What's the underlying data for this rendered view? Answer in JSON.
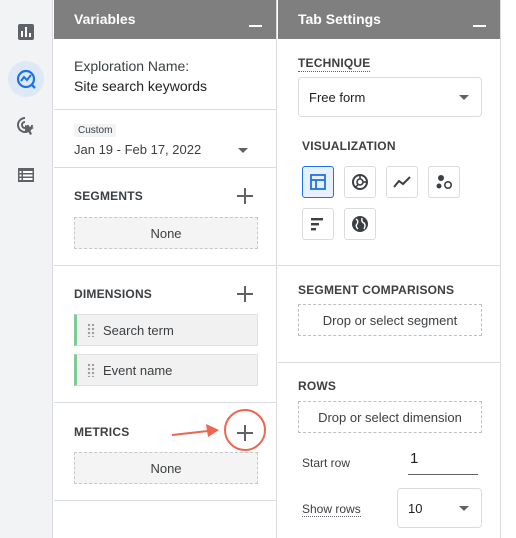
{
  "rail": {
    "items": [
      {
        "icon": "bar-chart-icon"
      },
      {
        "icon": "explore-icon",
        "active": true
      },
      {
        "icon": "ads-click-icon"
      },
      {
        "icon": "table-list-icon"
      }
    ]
  },
  "variables": {
    "title": "Variables",
    "exploration_label": "Exploration Name:",
    "exploration_name": "Site search keywords",
    "date_badge": "Custom",
    "date_range": "Jan 19 - Feb 17, 2022",
    "segments": {
      "title": "SEGMENTS",
      "empty": "None"
    },
    "dimensions": {
      "title": "DIMENSIONS",
      "items": [
        "Search term",
        "Event name"
      ]
    },
    "metrics": {
      "title": "METRICS",
      "empty": "None"
    }
  },
  "tab_settings": {
    "title": "Tab Settings",
    "technique_title": "TECHNIQUE",
    "technique_value": "Free form",
    "visualization_title": "VISUALIZATION",
    "visualizations": [
      "table-icon",
      "donut-chart-icon",
      "line-chart-icon",
      "scatter-plot-icon",
      "bar-chart-horizontal-icon",
      "geo-map-icon"
    ],
    "selected_visualization": "table-icon",
    "segment_comparisons_title": "SEGMENT COMPARISONS",
    "segment_drop": "Drop or select segment",
    "rows_title": "ROWS",
    "rows_drop": "Drop or select dimension",
    "start_row_label": "Start row",
    "start_row_value": "1",
    "show_rows_label": "Show rows",
    "show_rows_value": "10"
  },
  "colors": {
    "accent": "#1a73e8",
    "header": "#7f7f7f",
    "annotation": "#f0654f",
    "dimension_chip": "#81c995"
  }
}
